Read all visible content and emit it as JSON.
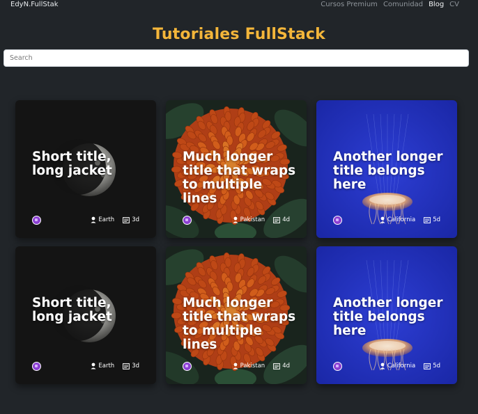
{
  "nav": {
    "brand": "EdyN.FullStak",
    "links": [
      "Cursos Premium",
      "Comunidad",
      "Blog",
      "CV"
    ],
    "active": "Blog"
  },
  "page": {
    "title": "Tutoriales FullStack"
  },
  "search": {
    "placeholder": "Search",
    "value": ""
  },
  "cards": [
    {
      "title": "Short title, long jacket",
      "location": "Earth",
      "days": "3d",
      "theme": "moon"
    },
    {
      "title": "Much longer title that wraps to multiple lines",
      "location": "Pakistan",
      "days": "4d",
      "theme": "flower"
    },
    {
      "title": "Another longer title belongs here",
      "location": "California",
      "days": "5d",
      "theme": "jellyfish"
    },
    {
      "title": "Short title, long jacket",
      "location": "Earth",
      "days": "3d",
      "theme": "moon"
    },
    {
      "title": "Much longer title that wraps to multiple lines",
      "location": "Pakistan",
      "days": "4d",
      "theme": "flower"
    },
    {
      "title": "Another longer title belongs here",
      "location": "California",
      "days": "5d",
      "theme": "jellyfish"
    }
  ],
  "colors": {
    "background": "#212529",
    "title": "#f4b63a",
    "avatar": "#8b3fd1"
  }
}
